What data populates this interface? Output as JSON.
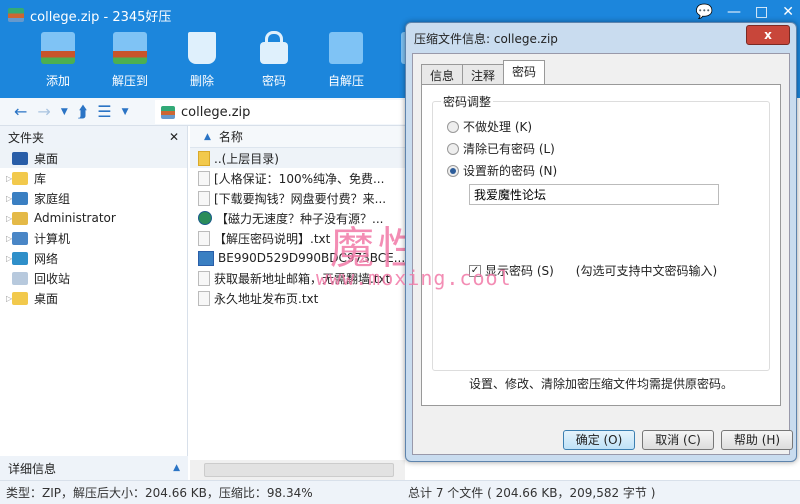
{
  "window": {
    "title": "college.zip - 2345好压",
    "controls": [
      "💬",
      "—",
      "□",
      "✕"
    ]
  },
  "toolbar": [
    {
      "label": "添加",
      "icon": "add-icon",
      "cls": "add"
    },
    {
      "label": "解压到",
      "icon": "extract-icon",
      "cls": "ext"
    },
    {
      "label": "删除",
      "icon": "recycle-bin-icon",
      "cls": "del"
    },
    {
      "label": "密码",
      "icon": "lock-icon",
      "cls": "lock"
    },
    {
      "label": "自解压",
      "icon": "self-extract-icon",
      "cls": "box"
    },
    {
      "label": "工具",
      "icon": "tools-icon",
      "cls": "box"
    }
  ],
  "nav": {
    "address": "college.zip"
  },
  "left": {
    "header": "文件夹",
    "close": "✕",
    "items": [
      {
        "label": "桌面",
        "color": "#2a5ea8",
        "tri": ""
      },
      {
        "label": "库",
        "color": "#f2c94c",
        "tri": "▷"
      },
      {
        "label": "家庭组",
        "color": "#3a7fc2",
        "tri": "▷"
      },
      {
        "label": "Administrator",
        "color": "#e4b947",
        "tri": "▷"
      },
      {
        "label": "计算机",
        "color": "#4a86c6",
        "tri": "▷"
      },
      {
        "label": "网络",
        "color": "#2f8fc9",
        "tri": "▷"
      },
      {
        "label": "回收站",
        "color": "#b7c9dd",
        "tri": ""
      },
      {
        "label": "桌面",
        "color": "#f2c94c",
        "tri": "▷"
      }
    ],
    "footer": "详细信息"
  },
  "files": {
    "column": "名称",
    "rows": [
      "..(上层目录)",
      "[人格保证：100%纯净、免费...",
      "[下载要掏钱？网盘要付费？来...",
      "【磁力无速度？种子没有源？...",
      "【解压密码说明】.txt",
      "BE990D529D990BDC973BCE...",
      "获取最新地址邮箱，无需翻墙.txt",
      "永久地址发布页.txt"
    ]
  },
  "status": {
    "left": "类型：ZIP，解压后大小：204.66 KB，压缩比：98.34%",
    "right": "总计 7 个文件 ( 204.66 KB，209,582 字节 )"
  },
  "dialog": {
    "title": "压缩文件信息: college.zip",
    "close": "x",
    "tabs": [
      "信息",
      "注释",
      "密码"
    ],
    "active_tab": 2,
    "group": "密码调整",
    "options": [
      "不做处理 (K)",
      "清除已有密码 (L)",
      "设置新的密码 (N)"
    ],
    "selected_option": 2,
    "password": "我爱魔性论坛",
    "show_password": "显示密码 (S)",
    "show_password_checked": true,
    "hint": "(勾选可支持中文密码输入)",
    "note": "设置、修改、清除加密压缩文件均需提供原密码。",
    "buttons": {
      "ok": "确定 (O)",
      "cancel": "取消 (C)",
      "help": "帮助 (H)"
    }
  },
  "watermark": {
    "text": "魔性论坛",
    "url": "www.moxing.cool"
  },
  "colors": {
    "brand": "#1c86dc",
    "watermark": "#f27aa8"
  }
}
